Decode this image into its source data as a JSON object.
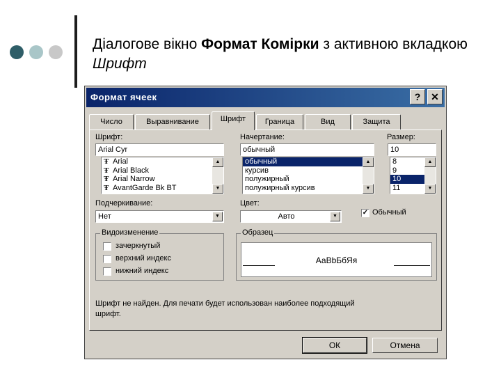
{
  "slide": {
    "title_part1": "Діалогове вікно ",
    "title_bold": "Формат Комірки",
    "title_part2": " з активною вкладкою ",
    "title_italic": "Шрифт",
    "dot_colors": [
      "#2f5e68",
      "#a9c6c8",
      "#c8c8c8"
    ]
  },
  "dialog": {
    "title": "Формат ячеек",
    "help_label": "?",
    "close_label": "✕",
    "tabs": [
      {
        "label": "Число"
      },
      {
        "label": "Выравнивание"
      },
      {
        "label": "Шрифт"
      },
      {
        "label": "Граница"
      },
      {
        "label": "Вид"
      },
      {
        "label": "Защита"
      }
    ],
    "font": {
      "label": "Шрифт:",
      "value": "Arial Cyr",
      "items": [
        "Arial",
        "Arial Black",
        "Arial Narrow",
        "AvantGarde Bk BT"
      ],
      "font_icon": "truetype-icon"
    },
    "style": {
      "label": "Начертание:",
      "value": "обычный",
      "items": [
        "обычный",
        "курсив",
        "полужирный",
        "полужирный курсив"
      ]
    },
    "size": {
      "label": "Размер:",
      "value": "10",
      "items": [
        "8",
        "9",
        "10",
        "11"
      ]
    },
    "underline": {
      "label": "Подчеркивание:",
      "value": "Нет"
    },
    "color": {
      "label": "Цвет:",
      "value": "Авто"
    },
    "normal_checkbox": {
      "label": "Обычный",
      "checked": true
    },
    "effects": {
      "title": "Видоизменение",
      "items": [
        {
          "label": "зачеркнутый",
          "checked": false
        },
        {
          "label": "верхний индекс",
          "checked": false
        },
        {
          "label": "нижний индекс",
          "checked": false
        }
      ]
    },
    "sample": {
      "title": "Образец",
      "text": "АаBbБбЯя"
    },
    "message_line1": "Шрифт не найден. Для печати будет использован наиболее подходящий",
    "message_line2": "шрифт.",
    "ok_label": "ОК",
    "cancel_label": "Отмена"
  }
}
